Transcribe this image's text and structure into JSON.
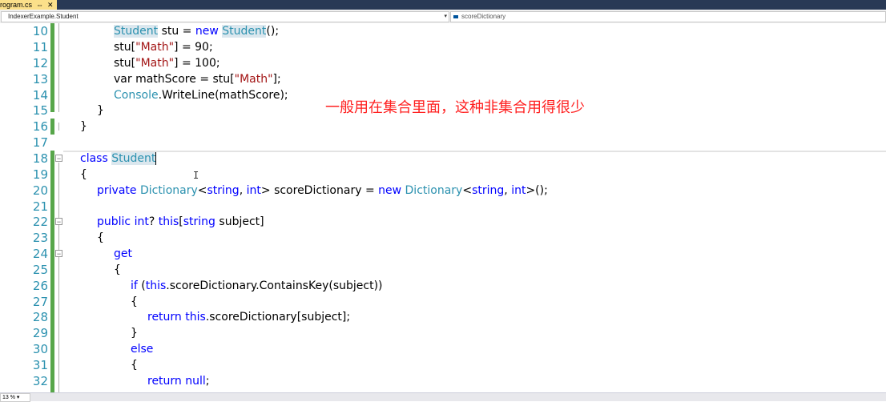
{
  "tab": {
    "title": "rogram.cs",
    "pin_glyph": "⇔",
    "close_glyph": "✕"
  },
  "navigation": {
    "type_selector": "IndexerExample.Student",
    "member_selector": "scoreDictionary"
  },
  "editor": {
    "line_numbers": [
      "10",
      "11",
      "12",
      "13",
      "14",
      "15",
      "16",
      "17",
      "18",
      "19",
      "20",
      "21",
      "22",
      "23",
      "24",
      "25",
      "26",
      "27",
      "28",
      "29",
      "30",
      "31",
      "32"
    ],
    "annotation": "一般用在集合里面，这种非集合用得很少"
  },
  "tokens": {
    "Student": "Student",
    "stu": "stu",
    "new": "new",
    "Math": "\"Math\"",
    "var": "var",
    "mathScore": "mathScore",
    "Console": "Console",
    "WriteLine": "WriteLine",
    "class": "class",
    "private": "private",
    "Dictionary": "Dictionary",
    "string": "string",
    "int": "int",
    "scoreDictionary": "scoreDictionary",
    "public": "public",
    "this": "this",
    "subject": "subject",
    "get": "get",
    "if": "if",
    "ContainsKey": "ContainsKey",
    "return": "return",
    "else": "else",
    "null": "null",
    "n90": "90",
    "n100": "100"
  },
  "status": {
    "zoom": "13 %"
  },
  "colors": {
    "keyword": "#0000ff",
    "type": "#2b91af",
    "string": "#a31515",
    "line_number": "#2b91af",
    "annotation": "#ff2020",
    "gutter_change": "#57a64a"
  }
}
